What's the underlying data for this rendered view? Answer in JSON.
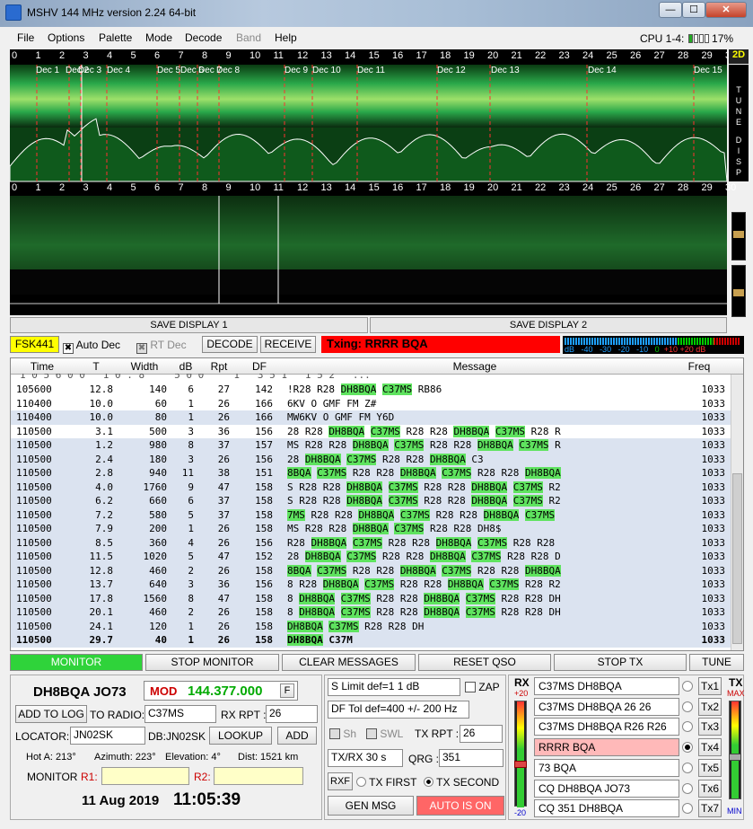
{
  "window": {
    "title": "MSHV 144 MHz version 2.24 64-bit",
    "btn_min": "—",
    "btn_max": "☐",
    "btn_close": "✕"
  },
  "menu": [
    "File",
    "Options",
    "Palette",
    "Mode",
    "Decode",
    "Band",
    "Help"
  ],
  "cpu": {
    "label": "CPU 1-4:",
    "percent": "17%"
  },
  "spectrum": {
    "ticks": [
      "0",
      "1",
      "2",
      "3",
      "4",
      "5",
      "6",
      "7",
      "8",
      "9",
      "10",
      "11",
      "12",
      "13",
      "14",
      "15",
      "16",
      "17",
      "18",
      "19",
      "20",
      "21",
      "22",
      "23",
      "24",
      "25",
      "26",
      "27",
      "28",
      "29",
      "30"
    ],
    "dec_labels": [
      "Dec 1",
      "Dec 2",
      "Dec 3",
      "Dec 4",
      "Dec 5",
      "Dec 6",
      "Dec 7",
      "Dec 8",
      "Dec 9",
      "Dec 10",
      "Dec 11",
      "Dec 12",
      "Dec 13",
      "Dec 14",
      "Dec 15"
    ],
    "side_2d": "2D",
    "side_tune": "T U N E",
    "side_disp": "D I S P"
  },
  "save": {
    "btn1": "SAVE DISPLAY 1",
    "btn2": "SAVE DISPLAY 2"
  },
  "controls": {
    "mode": "FSK441",
    "auto_dec": "Auto Dec",
    "auto_dec_check": "✖",
    "rt_dec": "RT Dec",
    "rt_dec_check": "✖",
    "decode": "DECODE",
    "receive": "RECEIVE",
    "txing": "Txing: RRRR BQA"
  },
  "meter": {
    "labels": [
      "dB",
      "-40",
      "-30",
      "-20",
      "-10",
      "0",
      "+10",
      "+20 dB"
    ]
  },
  "table": {
    "headers": [
      "Time",
      "T",
      "Width",
      "dB",
      "Rpt",
      "DF",
      "Message",
      "Freq"
    ],
    "partial": "1 0 5 6 0 0   1 0 . 8     5 0 0     1   3 5 1   1 5 2   ...",
    "rows": [
      {
        "time": "105600",
        "t": "12.8",
        "width": "140",
        "db": "6",
        "rpt": "27",
        "df": "142",
        "msg": [
          "!R28 R28 ",
          "DH8BQA",
          " ",
          "C37MS",
          " RB86"
        ],
        "freq": "1033",
        "hl": false
      },
      {
        "time": "110400",
        "t": "10.0",
        "width": "60",
        "db": "1",
        "rpt": "26",
        "df": "166",
        "msg": [
          "6KV O GMF FM Z#"
        ],
        "freq": "1033",
        "hl": false
      },
      {
        "time": "110400",
        "t": "10.0",
        "width": "80",
        "db": "1",
        "rpt": "26",
        "df": "166",
        "msg": [
          "MW6KV O GMF FM Y6D"
        ],
        "freq": "1033",
        "hl": true
      },
      {
        "time": "110500",
        "t": "3.1",
        "width": "500",
        "db": "3",
        "rpt": "36",
        "df": "156",
        "msg": [
          "28 R28 ",
          "DH8BQA",
          " ",
          "C37MS",
          " R28 R28 ",
          "DH8BQA",
          " ",
          "C37MS",
          " R28 R"
        ],
        "freq": "1033",
        "hl": false
      },
      {
        "time": "110500",
        "t": "1.2",
        "width": "980",
        "db": "8",
        "rpt": "37",
        "df": "157",
        "msg": [
          "MS R28 R28 ",
          "DH8BQA",
          " ",
          "C37MS",
          " R28 R28 ",
          "DH8BQA",
          " ",
          "C37MS",
          " R"
        ],
        "freq": "1033",
        "hl": true
      },
      {
        "time": "110500",
        "t": "2.4",
        "width": "180",
        "db": "3",
        "rpt": "26",
        "df": "156",
        "msg": [
          "28 ",
          "DH8BQA",
          " ",
          "C37MS",
          " R28 R28 ",
          "DH8BQA",
          " C3"
        ],
        "freq": "1033",
        "hl": true
      },
      {
        "time": "110500",
        "t": "2.8",
        "width": "940",
        "db": "11",
        "rpt": "38",
        "df": "151",
        "msg": [
          "8BQA",
          " ",
          "C37MS",
          " R28 R28 ",
          "DH8BQA",
          " ",
          "C37MS",
          " R28 R28 ",
          "DH8BQA"
        ],
        "freq": "1033",
        "hl": true
      },
      {
        "time": "110500",
        "t": "4.0",
        "width": "1760",
        "db": "9",
        "rpt": "47",
        "df": "158",
        "msg": [
          "S R28 R28 ",
          "DH8BQA",
          " ",
          "C37MS",
          " R28 R28 ",
          "DH8BQA",
          " ",
          "C37MS",
          " R2"
        ],
        "freq": "1033",
        "hl": true
      },
      {
        "time": "110500",
        "t": "6.2",
        "width": "660",
        "db": "6",
        "rpt": "37",
        "df": "158",
        "msg": [
          "S R28 R28 ",
          "DH8BQA",
          " ",
          "C37MS",
          " R28 R28 ",
          "DH8BQA",
          " ",
          "C37MS",
          " R2"
        ],
        "freq": "1033",
        "hl": true
      },
      {
        "time": "110500",
        "t": "7.2",
        "width": "580",
        "db": "5",
        "rpt": "37",
        "df": "158",
        "msg": [
          "7MS",
          " R28 R28 ",
          "DH8BQA",
          " ",
          "C37MS",
          " R28 R28 ",
          "DH8BQA",
          " ",
          "C37MS"
        ],
        "freq": "1033",
        "hl": true
      },
      {
        "time": "110500",
        "t": "7.9",
        "width": "200",
        "db": "1",
        "rpt": "26",
        "df": "158",
        "msg": [
          "MS R28 R28 ",
          "DH8BQA",
          " ",
          "C37MS",
          " R28 R28 DH8$"
        ],
        "freq": "1033",
        "hl": true
      },
      {
        "time": "110500",
        "t": "8.5",
        "width": "360",
        "db": "4",
        "rpt": "26",
        "df": "156",
        "msg": [
          "R28 ",
          "DH8BQA",
          " ",
          "C37MS",
          " R28 R28 ",
          "DH8BQA",
          " ",
          "C37MS",
          " R28 R28"
        ],
        "freq": "1033",
        "hl": true
      },
      {
        "time": "110500",
        "t": "11.5",
        "width": "1020",
        "db": "5",
        "rpt": "47",
        "df": "152",
        "msg": [
          "28 ",
          "DH8BQA",
          " ",
          "C37MS",
          " R28 R28 ",
          "DH8BQA",
          " ",
          "C37MS",
          " R28 R28 D"
        ],
        "freq": "1033",
        "hl": true
      },
      {
        "time": "110500",
        "t": "12.8",
        "width": "460",
        "db": "2",
        "rpt": "26",
        "df": "158",
        "msg": [
          "8BQA",
          " ",
          "C37MS",
          " R28 R28 ",
          "DH8BQA",
          " ",
          "C37MS",
          " R28 R28 ",
          "DH8BQA"
        ],
        "freq": "1033",
        "hl": true
      },
      {
        "time": "110500",
        "t": "13.7",
        "width": "640",
        "db": "3",
        "rpt": "36",
        "df": "156",
        "msg": [
          "8 R28 ",
          "DH8BQA",
          " ",
          "C37MS",
          " R28 R28 ",
          "DH8BQA",
          " ",
          "C37MS",
          " R28 R2"
        ],
        "freq": "1033",
        "hl": true
      },
      {
        "time": "110500",
        "t": "17.8",
        "width": "1560",
        "db": "8",
        "rpt": "47",
        "df": "158",
        "msg": [
          "8 ",
          "DH8BQA",
          " ",
          "C37MS",
          " R28 R28 ",
          "DH8BQA",
          " ",
          "C37MS",
          " R28 R28 DH"
        ],
        "freq": "1033",
        "hl": true
      },
      {
        "time": "110500",
        "t": "20.1",
        "width": "460",
        "db": "2",
        "rpt": "26",
        "df": "158",
        "msg": [
          "8 ",
          "DH8BQA",
          " ",
          "C37MS",
          " R28 R28 ",
          "DH8BQA",
          " ",
          "C37MS",
          " R28 R28 DH"
        ],
        "freq": "1033",
        "hl": true
      },
      {
        "time": "110500",
        "t": "24.1",
        "width": "120",
        "db": "1",
        "rpt": "26",
        "df": "158",
        "msg": [
          "DH8BQA",
          " ",
          "C37MS",
          " R28 R28 DH"
        ],
        "freq": "1033",
        "hl": true
      },
      {
        "time": "110500",
        "t": "29.7",
        "width": "40",
        "db": "1",
        "rpt": "26",
        "df": "158",
        "msg": [
          "DH8BQA",
          " C37M"
        ],
        "freq": "1033",
        "hl": true,
        "bold": true
      }
    ]
  },
  "buttons": {
    "monitor": "MONITOR",
    "stop_monitor": "STOP MONITOR",
    "clear": "CLEAR MESSAGES",
    "reset": "RESET QSO",
    "stop_tx": "STOP TX",
    "tune": "TUNE"
  },
  "station": {
    "call": "DH8BQA JO73",
    "mod": "MOD",
    "freq": "144.377.000",
    "f": "F",
    "add_log": "ADD TO LOG",
    "to_radio_label": "TO RADIO:",
    "to_radio": "C37MS",
    "rx_rpt_label": "RX RPT :",
    "rx_rpt": "26",
    "locator_label": "LOCATOR:",
    "locator": "JN02SK",
    "db": "DB:JN02SK",
    "lookup": "LOOKUP",
    "add": "ADD",
    "hot": "Hot A: 213°",
    "azimuth": "Azimuth: 223°",
    "elevation": "Elevation: 4°",
    "dist": "Dist: 1521 km",
    "monitor": "MONITOR",
    "r1": "R1:",
    "r2": "R2:",
    "date": "11 Aug 2019",
    "time": "11:05:39"
  },
  "mid": {
    "slimit": "S Limit def=1  1  dB",
    "zap": "ZAP",
    "dftol": "DF Tol def=400 +/-  200  Hz",
    "sh": "Sh",
    "swl": "SWL",
    "tx_rpt_label": "TX RPT :",
    "tx_rpt": "26",
    "txrx": "TX/RX 30  s",
    "qrg_label": "QRG :",
    "qrg": "351",
    "rxf": "RXF",
    "tx_first": "TX FIRST",
    "tx_second": "TX SECOND",
    "gen_msg": "GEN MSG",
    "auto": "AUTO IS ON"
  },
  "right": {
    "rx": "RX",
    "rx_top": "+20",
    "rx_bot": "-20",
    "tx": "TX",
    "tx_max": "MAX",
    "tx_min": "MIN",
    "msgs": [
      {
        "text": "C37MS DH8BQA",
        "btn": "Tx1"
      },
      {
        "text": "C37MS DH8BQA 26 26",
        "btn": "Tx2"
      },
      {
        "text": "C37MS DH8BQA R26 R26",
        "btn": "Tx3"
      },
      {
        "text": "RRRR BQA",
        "btn": "Tx4"
      },
      {
        "text": "73 BQA",
        "btn": "Tx5"
      },
      {
        "text": "CQ DH8BQA JO73",
        "btn": "Tx6"
      },
      {
        "text": "CQ 351 DH8BQA",
        "btn": "Tx7"
      }
    ]
  }
}
